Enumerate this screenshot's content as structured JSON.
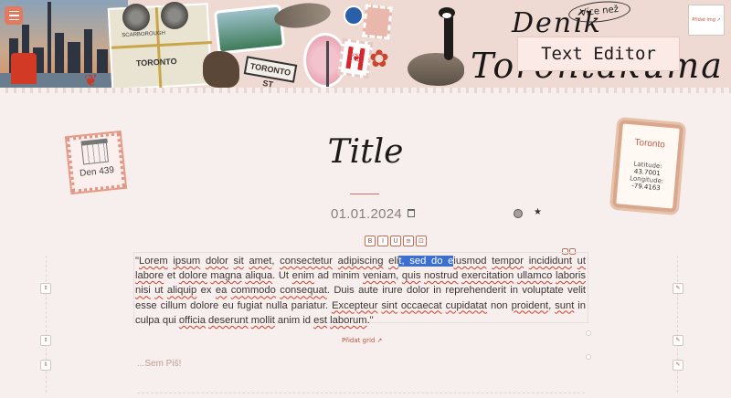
{
  "header": {
    "title_script_top": "Deník",
    "title_script_main": "Torontakuma",
    "editor_card": "Text Editor",
    "vice_nez": "Více než",
    "add_image": "Přidat img ↗",
    "collage": {
      "map_label": "TORONTO",
      "map_label_2": "SCARBOROUGH",
      "street_sign": "TORONTO ST"
    }
  },
  "day_stamp": {
    "label": "Den 439"
  },
  "location": {
    "city": "Toronto",
    "latitude_label": "Latitude:",
    "latitude_value": "43.7001",
    "longitude_label": "Longitude:",
    "longitude_value": "-79.4163"
  },
  "entry": {
    "title": "Title",
    "date": "01.01.2024",
    "text_before": "\"",
    "add_grid": "Přidat grid ↗",
    "placeholder": "...Sem Piš!"
  },
  "toolbar": {
    "bold": "B",
    "italic": "I",
    "underline": "U",
    "list": "≡",
    "link": "⊡"
  },
  "accent_color": "#c4523d",
  "selection_color": "#3c6fd0"
}
